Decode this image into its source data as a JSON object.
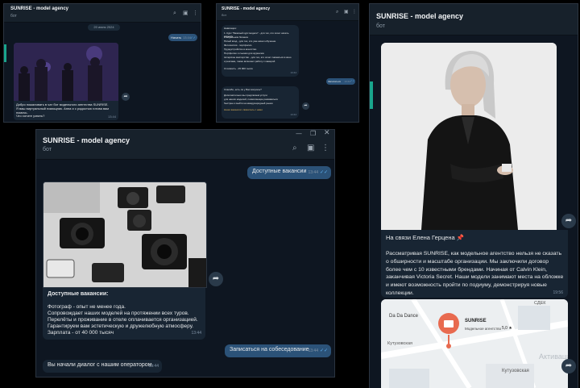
{
  "chat": {
    "title": "SUNRISE - model agency",
    "subtitle": "бот"
  },
  "win1": {
    "date": "20 июня 2024",
    "out_msg": "Начать",
    "out_time": "13:44",
    "in_lines": [
      "Добро пожаловать в чат бот модельного агентства SUNRISE.",
      "Я ваш виртуальный помощник. Анна и с радостью готова вам помочь.",
      "Что хотите узнать?"
    ],
    "in_time": "13:44"
  },
  "win2": {
    "msg1_lines": [
      "Навигация:",
      "1. Курс \"Базовый курс модели\" - для тех, кто хочет начать карьеру",
      "в модельном бизнесе",
      "Пятый вход - для тех, кто уже начал обучение",
      "Фотосессия - портфолио",
      "Трудоустройство в агентство",
      "Портфолио и съемки для журналов",
      "Актерское мастерство - для тех, кто хочет сниматься в кино",
      "и рекламе, также включает работу с камерой",
      "Стоимость - 25 000 тысяч"
    ],
    "msg1_time": "13:44",
    "out_msg": "Записаться",
    "out_time": "13:44",
    "msg2_lines": [
      "Спасибо, есть ли у Вас вопросы?",
      "Дополнительно мы предлагаем услуги",
      "для наших моделей, позволяющие развиваться",
      "быстрее и выйти на международный рынок",
      "Наши вакансии: свяжитесь с нами"
    ],
    "msg2_time": "13:44"
  },
  "win3": {
    "out_msg1": "Доступные вакансии",
    "out_time1": "13:44",
    "caption_title": "Доступные вакансии:",
    "caption_lines": [
      "Фотограф - опыт не менее года.",
      "Сопровождает наших моделей на протяжении всех туров.",
      "Перелёты и проживание в отеле оплачивается организацией.",
      "Гарантируем вам эстетическую и дружелюбную атмосферу.",
      "Зарплата - от 40 000 тысяч"
    ],
    "caption_time": "13:44",
    "out_msg2": "Записаться на собеседование",
    "out_time2": "13:44",
    "in_msg": "Вы начали диалог с нашим оператором.",
    "in_time": "13:44"
  },
  "win4": {
    "heading": "На связи Елена Герцена",
    "pin_emoji": "📌",
    "body": "Рассматривая SUNRISE, как модельное агентство нельзя не сказать о обширности и масштабе организации. Мы заключили договор более чем с 10 известными брендами. Начиная от Calvin Klein, заканчивая Victoria Secret. Наши модели занимают места на обложке и имеют возможность пройти по подиуму, демонстрируя новые коллекции.",
    "time": "19:56",
    "map": {
      "company": "SUNRISE",
      "company_sub": "Модельное агентство",
      "rating": "5,0 ★",
      "labels": [
        "Da Da Dance",
        "Кутузовская",
        "Кутузовская",
        "СДЕК"
      ],
      "watermark": "Активация"
    }
  },
  "colors": {
    "window_bg": "#0e1621",
    "header_bg": "#17212b",
    "bubble_in": "#182533",
    "bubble_out": "#2b5278",
    "accent": "#19a58c"
  }
}
